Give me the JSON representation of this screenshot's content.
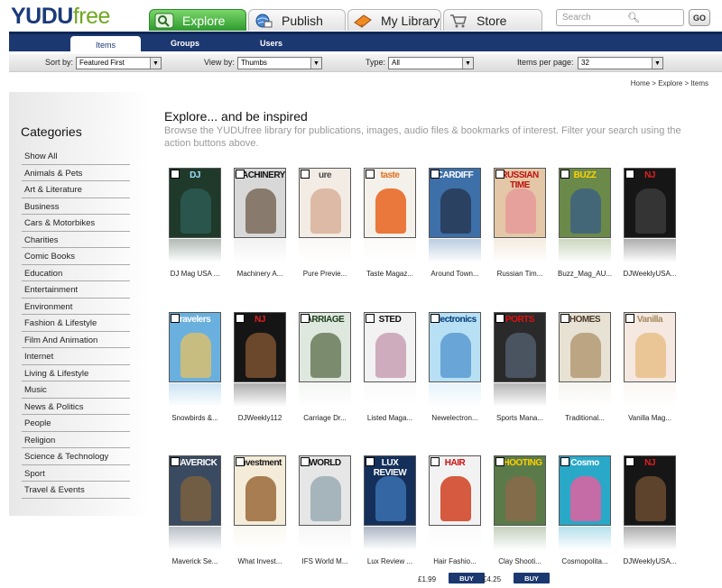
{
  "logo": {
    "part1": "YUDU",
    "part2": "free"
  },
  "nav": {
    "tabs": [
      {
        "label": "Explore",
        "icon": "search-icon"
      },
      {
        "label": "Publish",
        "icon": "globe-icon"
      },
      {
        "label": "My Library",
        "icon": "book-icon"
      },
      {
        "label": "Store",
        "icon": "cart-icon"
      }
    ]
  },
  "search": {
    "placeholder": "Search",
    "go_label": "GO"
  },
  "subnav": {
    "tabs": [
      "Items",
      "Groups",
      "Users"
    ]
  },
  "filters": {
    "sort_label": "Sort by:",
    "sort_value": "Featured First",
    "view_label": "View by:",
    "view_value": "Thumbs",
    "type_label": "Type:",
    "type_value": "All",
    "per_page_label": "Items per page:",
    "per_page_value": "32"
  },
  "breadcrumb": "Home > Explore > Items",
  "categories": {
    "title": "Categories",
    "items": [
      "Show All",
      "Animals & Pets",
      "Art & Literature",
      "Business",
      "Cars & Motorbikes",
      "Charities",
      "Comic Books",
      "Education",
      "Entertainment",
      "Environment",
      "Fashion & Lifestyle",
      "Film And Animation",
      "Internet",
      "Living & Lifestyle",
      "Music",
      "News & Politics",
      "People",
      "Religion",
      "Science & Technology",
      "Sport",
      "Travel & Events"
    ]
  },
  "main": {
    "title": "Explore... and be inspired",
    "description": "Browse the YUDUfree library for publications, images, audio files & bookmarks of interest. Filter your search using the action buttons above."
  },
  "magazines": [
    {
      "title": "DJ Mag USA ...",
      "cover_text": "DJ",
      "bg": "#1f3a2a",
      "fg": "#9be0ff",
      "fig": "#2c5a52"
    },
    {
      "title": "Machinery A...",
      "cover_text": "MACHINERY",
      "bg": "#d8d8d8",
      "fg": "#111111",
      "fig": "#7a6a5a"
    },
    {
      "title": "Pure Previe...",
      "cover_text": "ure",
      "bg": "#f2ece4",
      "fg": "#4a4a4a",
      "fig": "#d9b19a"
    },
    {
      "title": "Taste Magaz...",
      "cover_text": "taste",
      "bg": "#f4f1ea",
      "fg": "#e07020",
      "fig": "#e8621c"
    },
    {
      "title": "Around Town...",
      "cover_text": "CARDIFF",
      "bg": "#3d6fa8",
      "fg": "#ffffff",
      "fig": "#273a55"
    },
    {
      "title": "Russian Tim...",
      "cover_text": "RUSSIAN TIME",
      "bg": "#e3c7a6",
      "fg": "#c01010",
      "fig": "#e89a9a"
    },
    {
      "title": "Buzz_Mag_AU...",
      "cover_text": "BUZZ",
      "bg": "#6b8a4a",
      "fg": "#ffd400",
      "fig": "#3d6080"
    },
    {
      "title": "DJWeeklyUSA...",
      "cover_text": "NJ",
      "bg": "#161616",
      "fg": "#e02020",
      "fig": "#3a3a3a"
    },
    {
      "title": "Snowbirds &...",
      "cover_text": "ravelers",
      "bg": "#6ab0de",
      "fg": "#ffffff",
      "fig": "#d8c070"
    },
    {
      "title": "DJWeekly112",
      "cover_text": "NJ",
      "bg": "#151515",
      "fg": "#e02020",
      "fig": "#7a5030"
    },
    {
      "title": "Carriage Dr...",
      "cover_text": "ARRIAGE",
      "bg": "#dfe8df",
      "fg": "#1b3d1b",
      "fig": "#6a7a5a"
    },
    {
      "title": "Listed Maga...",
      "cover_text": "STED",
      "bg": "#f2f2f2",
      "fg": "#111111",
      "fig": "#c9a0b4"
    },
    {
      "title": "Newelectron...",
      "cover_text": "electronics",
      "bg": "#b8e0f4",
      "fg": "#003a7a",
      "fig": "#5a9ad0"
    },
    {
      "title": "Sports Mana...",
      "cover_text": "PORTS",
      "bg": "#2a2a2a",
      "fg": "#e01010",
      "fig": "#505a6a"
    },
    {
      "title": "Traditional...",
      "cover_text": "HOMES",
      "bg": "#e8e2d4",
      "fg": "#4a3a2a",
      "fig": "#b49a74"
    },
    {
      "title": "Vanilla Mag...",
      "cover_text": "Vanilla",
      "bg": "#f4e8e0",
      "fg": "#a58a60",
      "fig": "#e8c08a"
    },
    {
      "title": "Maverick Se...",
      "cover_text": "MAVERICK",
      "bg": "#3a4a60",
      "fg": "#ffffff",
      "fig": "#7a6040"
    },
    {
      "title": "What Invest...",
      "cover_text": "investment",
      "bg": "#f4ecd8",
      "fg": "#1a1a1a",
      "fig": "#9a6a3a"
    },
    {
      "title": "IFS World M...",
      "cover_text": "WORLD",
      "bg": "#e6e6e6",
      "fg": "#111111",
      "fig": "#9aaab4"
    },
    {
      "title": "Lux Review ...",
      "cover_text": "LUX REVIEW",
      "bg": "#14305a",
      "fg": "#ffffff",
      "fig": "#3a70b0"
    },
    {
      "title": "Hair Fashio...",
      "cover_text": "HAIR",
      "bg": "#f2f2f2",
      "fg": "#d01010",
      "fig": "#d04020",
      "price": "£1.99",
      "buy_label": "BUY"
    },
    {
      "title": "Clay Shooti...",
      "cover_text": "SHOOTING",
      "bg": "#5a7a4a",
      "fg": "#ffd000",
      "fig": "#8a6a4a",
      "price": "£4.25",
      "buy_label": "BUY"
    },
    {
      "title": "Cosmopolita...",
      "cover_text": "Cosmo",
      "bg": "#2aa8c8",
      "fg": "#ffffff",
      "fig": "#e060a0"
    },
    {
      "title": "DJWeeklyUSA...",
      "cover_text": "NJ",
      "bg": "#161616",
      "fg": "#e02020",
      "fig": "#6a4a30"
    }
  ]
}
